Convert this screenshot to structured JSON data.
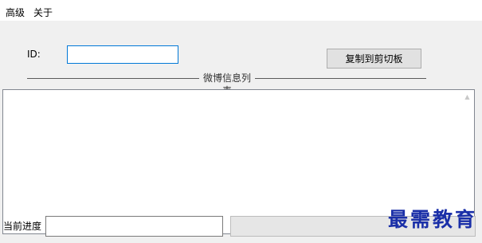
{
  "menu": {
    "items": [
      {
        "label": "高级"
      },
      {
        "label": "关于"
      }
    ]
  },
  "form": {
    "id_label": "ID:",
    "id_value": "",
    "copy_button_label": "复制到剪切板"
  },
  "group": {
    "title": "微博信息列表"
  },
  "list": {
    "items": []
  },
  "progress": {
    "label": "当前进度",
    "text_value": "",
    "fraction": 0
  },
  "watermark": {
    "text": "最需教育"
  },
  "colors": {
    "input_focus_border": "#0078d7",
    "progress_fill": "#06b025",
    "watermark": "#1a2fa8"
  }
}
